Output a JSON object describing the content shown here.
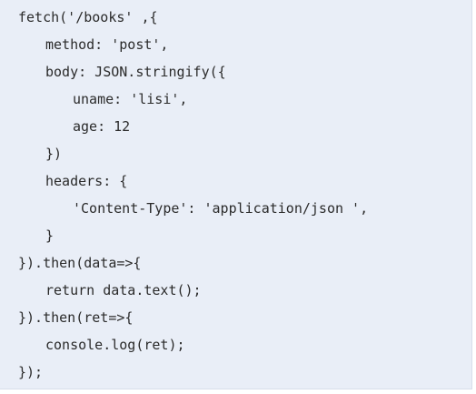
{
  "code": {
    "lines": [
      "fetch('/books' ,{",
      "method: 'post',",
      "body: JSON.stringify({",
      "uname: 'lisi',",
      "age: 12",
      "})",
      "headers: {",
      "'Content-Type': 'application/json ',",
      "}",
      "}).then(data=>{",
      "return data.text();",
      "}).then(ret=>{",
      "console.log(ret);",
      "});"
    ]
  },
  "colors": {
    "panel_background": "#e9eef7",
    "text": "#2b2b2b"
  }
}
